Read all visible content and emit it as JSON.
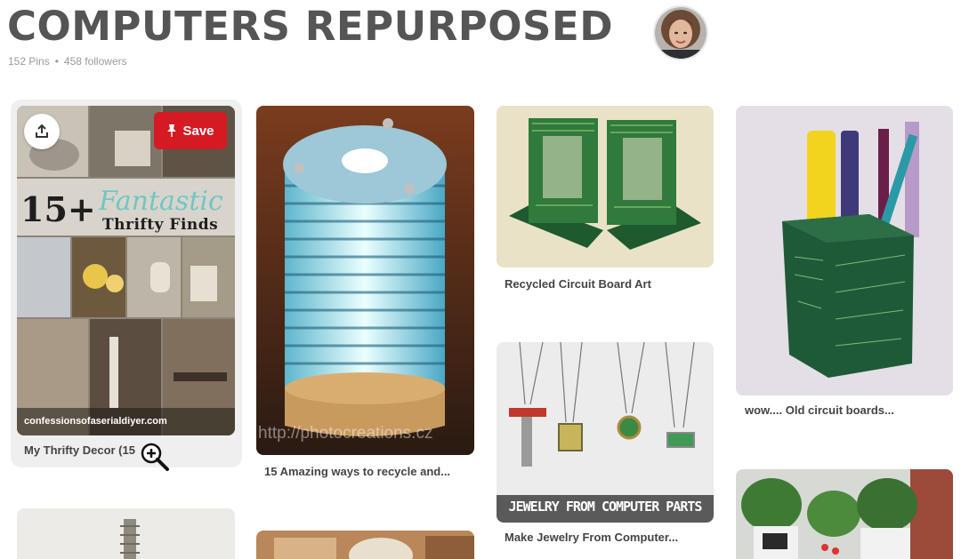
{
  "board": {
    "title": "COMPUTERS REPURPOSED",
    "pins_count": "152 Pins",
    "separator": "•",
    "followers_count": "458 followers"
  },
  "pin_actions": {
    "save_label": "Save",
    "save_color": "#d51a23"
  },
  "pins": [
    {
      "caption": "My Thrifty Decor (15",
      "overlay_big": "15+",
      "overlay_script": "Fantastic",
      "overlay_sub": "Thrifty Finds",
      "watermark": "confessionsofaserialdiyer.com"
    },
    {
      "caption": "15 Amazing ways to recycle and...",
      "watermark": "http://photocreations.cz"
    },
    {
      "caption": "Recycled Circuit Board Art"
    },
    {
      "caption": "wow.... Old circuit boards..."
    },
    {
      "caption": "Make Jewelry From Computer...",
      "banner": "JEWELRY FROM COMPUTER PARTS"
    }
  ],
  "icons": {
    "share": "upload-share-icon",
    "pin": "pushpin-icon",
    "zoom": "zoom-in-icon"
  }
}
